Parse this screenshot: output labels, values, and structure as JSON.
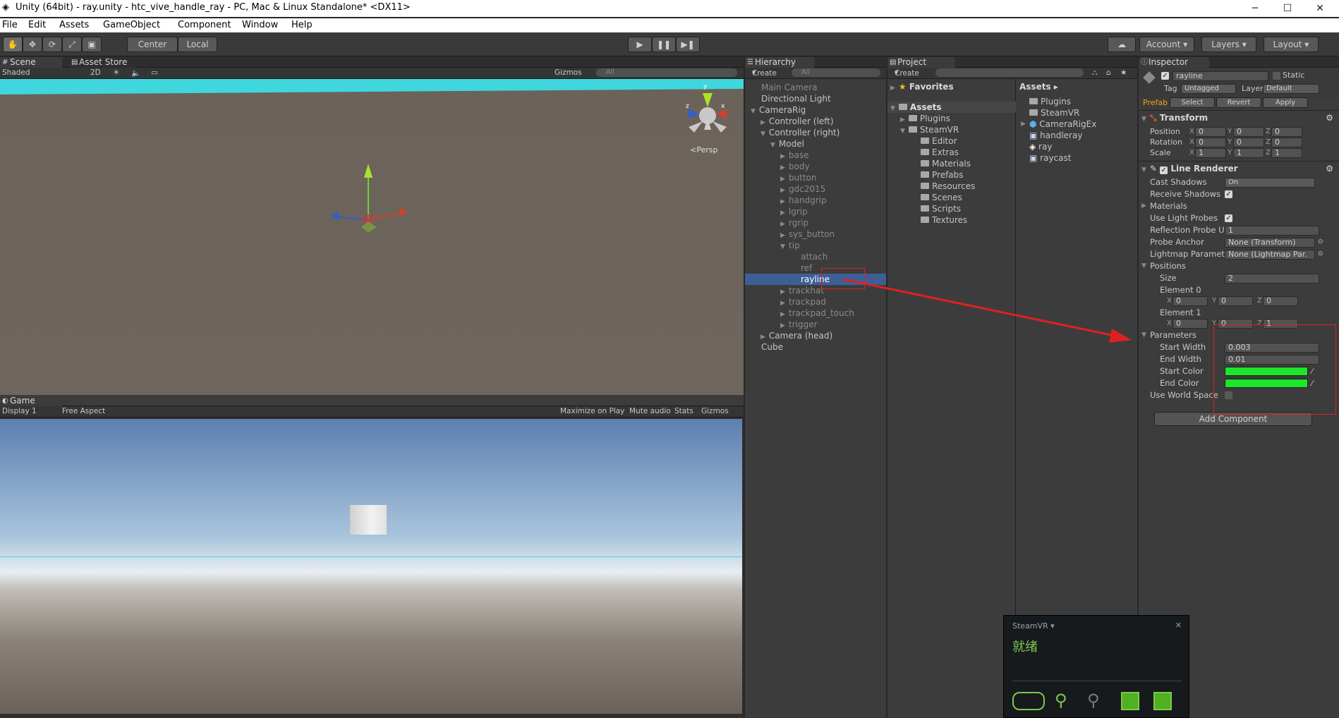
{
  "window": {
    "title": "Unity (64bit) - ray.unity - htc_vive_handle_ray - PC, Mac & Linux Standalone* <DX11>",
    "minimize": "─",
    "maximize": "☐",
    "close": "✕"
  },
  "menu": [
    "File",
    "Edit",
    "Assets",
    "GameObject",
    "Component",
    "Window",
    "Help"
  ],
  "toolbar": {
    "pivot": "Center",
    "space": "Local",
    "play": "▶",
    "pause": "❚❚",
    "step": "▶❚",
    "account": "Account",
    "layers": "Layers",
    "layout": "Layout"
  },
  "scene": {
    "tab": "Scene",
    "tab2": "Asset Store",
    "shading": "Shaded",
    "mode_2d": "2D",
    "gizmos": "Gizmos",
    "search": "All",
    "persp": "Persp",
    "axis_x": "x",
    "axis_y": "y",
    "axis_z": "z"
  },
  "game": {
    "tab": "Game",
    "display": "Display 1",
    "aspect": "Free Aspect",
    "maximize": "Maximize on Play",
    "mute": "Mute audio",
    "stats": "Stats",
    "gizmos": "Gizmos"
  },
  "hierarchy": {
    "tab": "Hierarchy",
    "create": "Create",
    "search": "All",
    "items": [
      {
        "label": "Main Camera",
        "depth": 0,
        "arrow": "",
        "dim": true
      },
      {
        "label": "Directional Light",
        "depth": 0,
        "arrow": ""
      },
      {
        "label": "CameraRig",
        "depth": 0,
        "arrow": "▼"
      },
      {
        "label": "Controller (left)",
        "depth": 1,
        "arrow": "▶"
      },
      {
        "label": "Controller (right)",
        "depth": 1,
        "arrow": "▼"
      },
      {
        "label": "Model",
        "depth": 2,
        "arrow": "▼"
      },
      {
        "label": "base",
        "depth": 3,
        "arrow": "▶",
        "dim": true
      },
      {
        "label": "body",
        "depth": 3,
        "arrow": "▶",
        "dim": true
      },
      {
        "label": "button",
        "depth": 3,
        "arrow": "▶",
        "dim": true
      },
      {
        "label": "gdc2015",
        "depth": 3,
        "arrow": "▶",
        "dim": true
      },
      {
        "label": "handgrip",
        "depth": 3,
        "arrow": "▶",
        "dim": true
      },
      {
        "label": "lgrip",
        "depth": 3,
        "arrow": "▶",
        "dim": true
      },
      {
        "label": "rgrip",
        "depth": 3,
        "arrow": "▶",
        "dim": true
      },
      {
        "label": "sys_button",
        "depth": 3,
        "arrow": "▶",
        "dim": true
      },
      {
        "label": "tip",
        "depth": 3,
        "arrow": "▼",
        "dim": true
      },
      {
        "label": "attach",
        "depth": 4,
        "arrow": "",
        "dim": true
      },
      {
        "label": "ref",
        "depth": 4,
        "arrow": "",
        "dim": true
      },
      {
        "label": "rayline",
        "depth": 4,
        "arrow": "",
        "selected": true
      },
      {
        "label": "trackhat",
        "depth": 3,
        "arrow": "▶",
        "dim": true
      },
      {
        "label": "trackpad",
        "depth": 3,
        "arrow": "▶",
        "dim": true
      },
      {
        "label": "trackpad_touch",
        "depth": 3,
        "arrow": "▶",
        "dim": true
      },
      {
        "label": "trigger",
        "depth": 3,
        "arrow": "▶",
        "dim": true
      },
      {
        "label": "Camera (head)",
        "depth": 1,
        "arrow": "▶"
      },
      {
        "label": "Cube",
        "depth": 0,
        "arrow": ""
      }
    ]
  },
  "project": {
    "tab": "Project",
    "create": "Create",
    "favorites": "Favorites",
    "assets_root": "Assets",
    "tree": [
      {
        "label": "Plugins",
        "depth": 1,
        "arrow": "▶"
      },
      {
        "label": "SteamVR",
        "depth": 1,
        "arrow": "▼"
      },
      {
        "label": "Editor",
        "depth": 2,
        "arrow": ""
      },
      {
        "label": "Extras",
        "depth": 2,
        "arrow": ""
      },
      {
        "label": "Materials",
        "depth": 2,
        "arrow": ""
      },
      {
        "label": "Prefabs",
        "depth": 2,
        "arrow": ""
      },
      {
        "label": "Resources",
        "depth": 2,
        "arrow": ""
      },
      {
        "label": "Scenes",
        "depth": 2,
        "arrow": ""
      },
      {
        "label": "Scripts",
        "depth": 2,
        "arrow": ""
      },
      {
        "label": "Textures",
        "depth": 2,
        "arrow": ""
      }
    ],
    "breadcrumb": "Assets ▸",
    "files": [
      {
        "label": "Plugins",
        "kind": "folder"
      },
      {
        "label": "SteamVR",
        "kind": "folder"
      },
      {
        "label": "CameraRigEx",
        "kind": "prefab"
      },
      {
        "label": "handleray",
        "kind": "script"
      },
      {
        "label": "ray",
        "kind": "unity"
      },
      {
        "label": "raycast",
        "kind": "script"
      }
    ]
  },
  "inspector": {
    "tab": "Inspector",
    "object_name": "rayline",
    "static": "Static",
    "tag_label": "Tag",
    "tag": "Untagged",
    "layer_label": "Layer",
    "layer": "Default",
    "prefab": "Prefab",
    "select": "Select",
    "revert": "Revert",
    "apply": "Apply",
    "transform": {
      "title": "Transform",
      "rows": [
        {
          "label": "Position",
          "x": "0",
          "y": "0",
          "z": "0"
        },
        {
          "label": "Rotation",
          "x": "0",
          "y": "0",
          "z": "0"
        },
        {
          "label": "Scale",
          "x": "1",
          "y": "1",
          "z": "1"
        }
      ]
    },
    "line_renderer": {
      "title": "Line Renderer",
      "cast_shadows_label": "Cast Shadows",
      "cast_shadows": "On",
      "receive_shadows_label": "Receive Shadows",
      "materials_label": "Materials",
      "use_light_probes_label": "Use Light Probes",
      "reflection_label": "Reflection Probe Usa",
      "reflection": "1",
      "probe_anchor_label": "Probe Anchor",
      "probe_anchor": "None (Transform)",
      "lightmap_label": "Lightmap Parameter",
      "lightmap": "None (Lightmap Par.",
      "positions_label": "Positions",
      "size_label": "Size",
      "size": "2",
      "element0_label": "Element 0",
      "e0": {
        "x": "0",
        "y": "0",
        "z": "0"
      },
      "element1_label": "Element 1",
      "e1": {
        "x": "0",
        "y": "0",
        "z": "1"
      },
      "parameters_label": "Parameters",
      "start_width_label": "Start Width",
      "start_width": "0.003",
      "end_width_label": "End Width",
      "end_width": "0.01",
      "start_color_label": "Start Color",
      "end_color_label": "End Color",
      "color": "#1be62a",
      "world_space_label": "Use World Space"
    },
    "add_component": "Add Component",
    "x": "X",
    "y": "Y",
    "z": "Z"
  },
  "steamvr": {
    "title": "SteamVR ▾",
    "status": "就绪",
    "close": "✕"
  }
}
